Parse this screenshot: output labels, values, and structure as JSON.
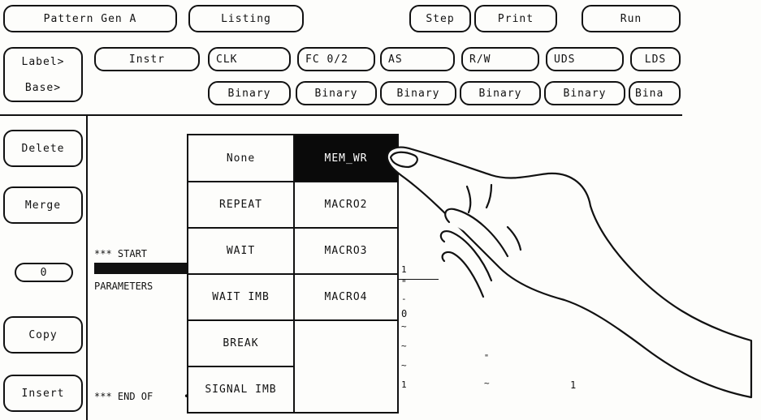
{
  "header": {
    "title": "Pattern Gen A",
    "menu": "Listing",
    "step": "Step",
    "print": "Print",
    "run": "Run"
  },
  "row_labels": {
    "label": "Label>",
    "base": "Base>"
  },
  "labels": [
    "Instr",
    "CLK",
    "FC 0/2",
    "AS",
    "R/W",
    "UDS",
    "LDS"
  ],
  "bases": [
    "Binary",
    "Binary",
    "Binary",
    "Binary",
    "Binary",
    "Bina"
  ],
  "side_buttons": {
    "delete": "Delete",
    "merge": "Merge",
    "counter": "0",
    "copy": "Copy",
    "insert": "Insert"
  },
  "listing": {
    "start": "*** START",
    "parameters": "PARAMETERS",
    "end": "*** END OF",
    "col_a": [
      "1",
      "\"",
      "-",
      "0",
      "~",
      "~",
      "~",
      "1"
    ],
    "col_b": [
      "\"\"\"",
      "\"\"\"",
      "\"\"\"",
      "\"\"\"",
      "\"\"\""
    ],
    "col_c": [
      "\"",
      "~"
    ],
    "col_d": [
      "1"
    ]
  },
  "popup": {
    "left_options": [
      "None",
      "REPEAT",
      "WAIT",
      "WAIT IMB",
      "BREAK",
      "SIGNAL IMB"
    ],
    "right_options": [
      "MEM_WR",
      "MACRO2",
      "MACRO3",
      "MACRO4"
    ],
    "selected": "MEM_WR"
  }
}
